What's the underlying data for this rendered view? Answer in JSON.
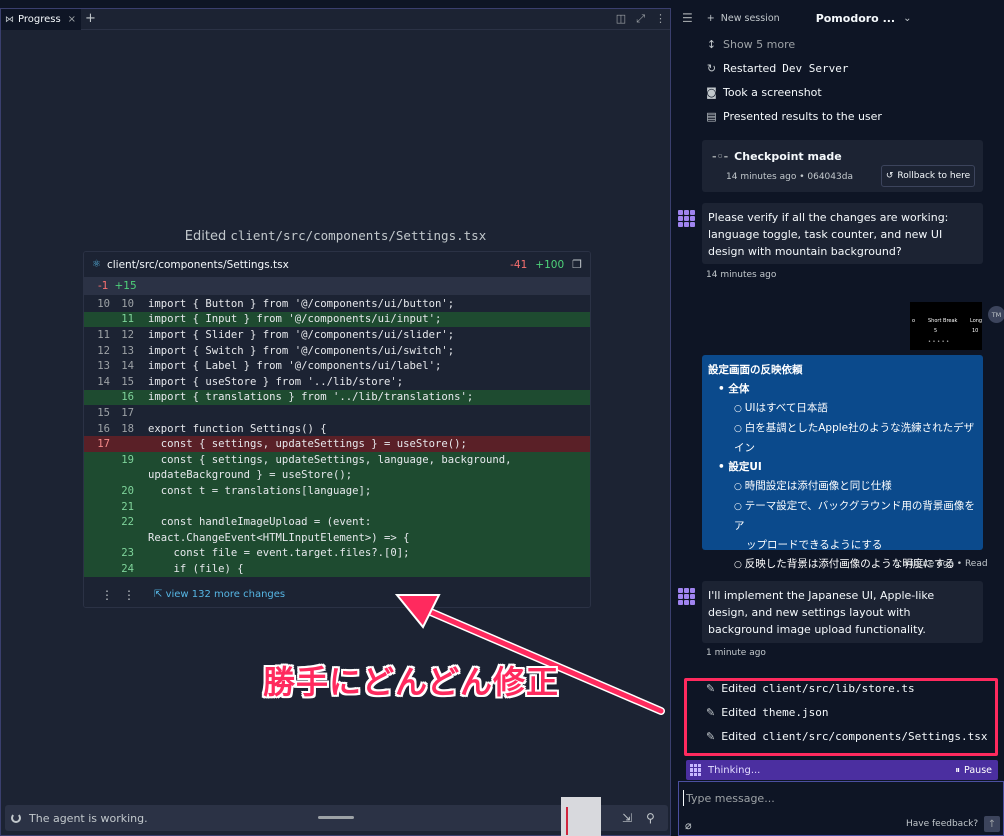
{
  "left_pane": {
    "tab_label": "Progress",
    "tab_close": "×",
    "tab_add": "+",
    "edit_title_prefix": "Edited",
    "edit_title_path": "client/src/components/Settings.tsx",
    "diff": {
      "file": "client/src/components/Settings.tsx",
      "deletions": "-41",
      "additions": "+100",
      "hunk_minus": "-1",
      "hunk_plus": "+15",
      "lines": [
        {
          "o": "10",
          "n": "10",
          "t": "import { Button } from '@/components/ui/button';",
          "k": "ctx"
        },
        {
          "o": "",
          "n": "11",
          "t": "import { Input } from '@/components/ui/input';",
          "k": "add"
        },
        {
          "o": "11",
          "n": "12",
          "t": "import { Slider } from '@/components/ui/slider';",
          "k": "ctx"
        },
        {
          "o": "12",
          "n": "13",
          "t": "import { Switch } from '@/components/ui/switch';",
          "k": "ctx"
        },
        {
          "o": "13",
          "n": "14",
          "t": "import { Label } from '@/components/ui/label';",
          "k": "ctx"
        },
        {
          "o": "14",
          "n": "15",
          "t": "import { useStore } from '../lib/store';",
          "k": "ctx"
        },
        {
          "o": "",
          "n": "16",
          "t": "import { translations } from '../lib/translations';",
          "k": "add"
        },
        {
          "o": "15",
          "n": "17",
          "t": "",
          "k": "ctx"
        },
        {
          "o": "16",
          "n": "18",
          "t": "export function Settings() {",
          "k": "ctx"
        },
        {
          "o": "17",
          "n": "",
          "t": "  const { settings, updateSettings } = useStore();",
          "k": "del"
        },
        {
          "o": "",
          "n": "19",
          "t": "  const { settings, updateSettings, language, background,",
          "k": "add"
        },
        {
          "o": "",
          "n": "",
          "t": "updateBackground } = useStore();",
          "k": "add"
        },
        {
          "o": "",
          "n": "20",
          "t": "  const t = translations[language];",
          "k": "add"
        },
        {
          "o": "",
          "n": "21",
          "t": "",
          "k": "add"
        },
        {
          "o": "",
          "n": "22",
          "t": "  const handleImageUpload = (event:",
          "k": "add"
        },
        {
          "o": "",
          "n": "",
          "t": "React.ChangeEvent<HTMLInputElement>) => {",
          "k": "add"
        },
        {
          "o": "",
          "n": "23",
          "t": "    const file = event.target.files?.[0];",
          "k": "add"
        },
        {
          "o": "",
          "n": "24",
          "t": "    if (file) {",
          "k": "add"
        }
      ],
      "more_changes": "view 132 more changes"
    },
    "annotation": "勝手にどんどん修正",
    "status": "The agent is working."
  },
  "right_pane": {
    "new_session": "New session",
    "title": "Pomodoro ...",
    "actions": {
      "show_more": "Show 5 more",
      "restarted_prefix": "Restarted",
      "restarted_name": "Dev Server",
      "screenshot": "Took a screenshot",
      "presented": "Presented results to the user"
    },
    "checkpoint": {
      "title": "Checkpoint made",
      "meta": "14 minutes ago • 064043da",
      "rollback": "Rollback to here"
    },
    "agent_msg_1": "Please verify if all the changes are working: language toggle, task counter, and new UI design with mountain background?",
    "agent_msg_1_time": "14 minutes ago",
    "thumb": {
      "left_char": "o",
      "label_short_break": "Short Break",
      "label_long": "Long",
      "value_mid": "5",
      "value_right": "10",
      "dots": "• • • • •"
    },
    "avatar": "TM",
    "user_msg": {
      "heading": "設定画面の反映依頼",
      "g1": "全体",
      "g1_i1": "UIはすべて日本語",
      "g1_i2": "白を基調としたApple社のような洗練されたデザイン",
      "g2": "設定UI",
      "g2_i1": "時間設定は添付画像と同じ仕様",
      "g2_i2a": "テーマ設定で、バックグラウンド用の背景画像をア",
      "g2_i2b": "ップロードできるようにする",
      "g2_i3": "反映した背景は添付画像のような明度にする",
      "time": "1 minute ago • Read"
    },
    "agent_msg_2": "I'll implement the Japanese UI, Apple-like design, and new settings layout with background image upload functionality.",
    "agent_msg_2_time": "1 minute ago",
    "edits": {
      "prefix": "Edited",
      "e1": "client/src/lib/store.ts",
      "e2": "theme.json",
      "e3": "client/src/components/Settings.tsx"
    },
    "thinking": "Thinking...",
    "pause": "Pause",
    "input_placeholder": "Type message...",
    "feedback": "Have feedback?"
  }
}
